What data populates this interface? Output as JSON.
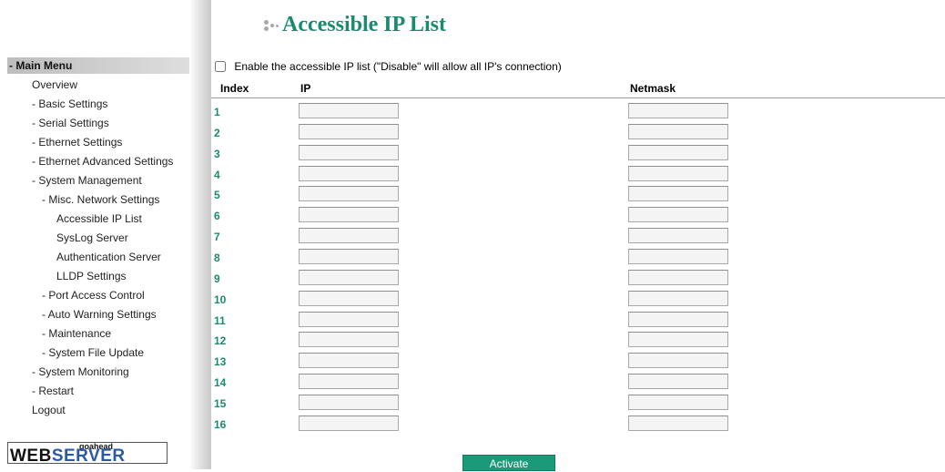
{
  "sidebar": {
    "header": "- Main Menu",
    "items": [
      {
        "label": "Overview",
        "level": 0
      },
      {
        "label": "- Basic Settings",
        "level": 0
      },
      {
        "label": "- Serial Settings",
        "level": 0
      },
      {
        "label": "- Ethernet Settings",
        "level": 0
      },
      {
        "label": "- Ethernet Advanced Settings",
        "level": 0
      },
      {
        "label": "- System Management",
        "level": 0
      },
      {
        "label": "- Misc. Network Settings",
        "level": 1
      },
      {
        "label": "Accessible IP List",
        "level": 2
      },
      {
        "label": "SysLog Server",
        "level": 2
      },
      {
        "label": "Authentication Server",
        "level": 2
      },
      {
        "label": "LLDP Settings",
        "level": 2
      },
      {
        "label": "- Port Access Control",
        "level": 1
      },
      {
        "label": "- Auto Warning Settings",
        "level": 1
      },
      {
        "label": "- Maintenance",
        "level": 1
      },
      {
        "label": "- System File Update",
        "level": 1
      },
      {
        "label": "- System Monitoring",
        "level": 0
      },
      {
        "label": "- Restart",
        "level": 0
      },
      {
        "label": "Logout",
        "level": 0
      }
    ],
    "logo": {
      "top": "goahead",
      "web": "WEB",
      "server": "SERVER"
    }
  },
  "page": {
    "title": "Accessible IP List",
    "enable_label": "Enable the accessible IP list (\"Disable\" will allow all IP's connection)",
    "enable_checked": false
  },
  "table": {
    "headers": {
      "index": "Index",
      "ip": "IP",
      "netmask": "Netmask"
    },
    "rows": [
      {
        "index": "1",
        "ip": "",
        "netmask": ""
      },
      {
        "index": "2",
        "ip": "",
        "netmask": ""
      },
      {
        "index": "3",
        "ip": "",
        "netmask": ""
      },
      {
        "index": "4",
        "ip": "",
        "netmask": ""
      },
      {
        "index": "5",
        "ip": "",
        "netmask": ""
      },
      {
        "index": "6",
        "ip": "",
        "netmask": ""
      },
      {
        "index": "7",
        "ip": "",
        "netmask": ""
      },
      {
        "index": "8",
        "ip": "",
        "netmask": ""
      },
      {
        "index": "9",
        "ip": "",
        "netmask": ""
      },
      {
        "index": "10",
        "ip": "",
        "netmask": ""
      },
      {
        "index": "11",
        "ip": "",
        "netmask": ""
      },
      {
        "index": "12",
        "ip": "",
        "netmask": ""
      },
      {
        "index": "13",
        "ip": "",
        "netmask": ""
      },
      {
        "index": "14",
        "ip": "",
        "netmask": ""
      },
      {
        "index": "15",
        "ip": "",
        "netmask": ""
      },
      {
        "index": "16",
        "ip": "",
        "netmask": ""
      }
    ]
  },
  "actions": {
    "activate_label": "Activate"
  },
  "colors": {
    "accent": "#1a8a70",
    "button": "#1a9a78",
    "logo_blue": "#2a5aa8"
  }
}
